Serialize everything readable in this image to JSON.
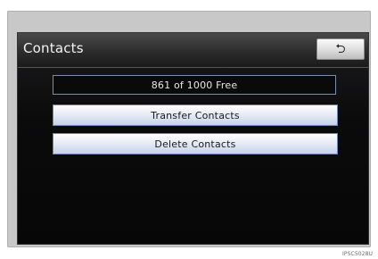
{
  "header": {
    "title": "Contacts",
    "back_icon": "⮌"
  },
  "main": {
    "storage_status": "861 of 1000  Free",
    "buttons": [
      {
        "label": "Transfer Contacts"
      },
      {
        "label": "Delete Contacts"
      }
    ]
  },
  "footer": {
    "ref_code": "IPSC5028U"
  },
  "colors": {
    "screen_bg": "#0b0b0c",
    "button_gradient_bottom": "#c6d2e8",
    "button_border": "#6e86b0",
    "status_border": "#7d8fa8"
  }
}
